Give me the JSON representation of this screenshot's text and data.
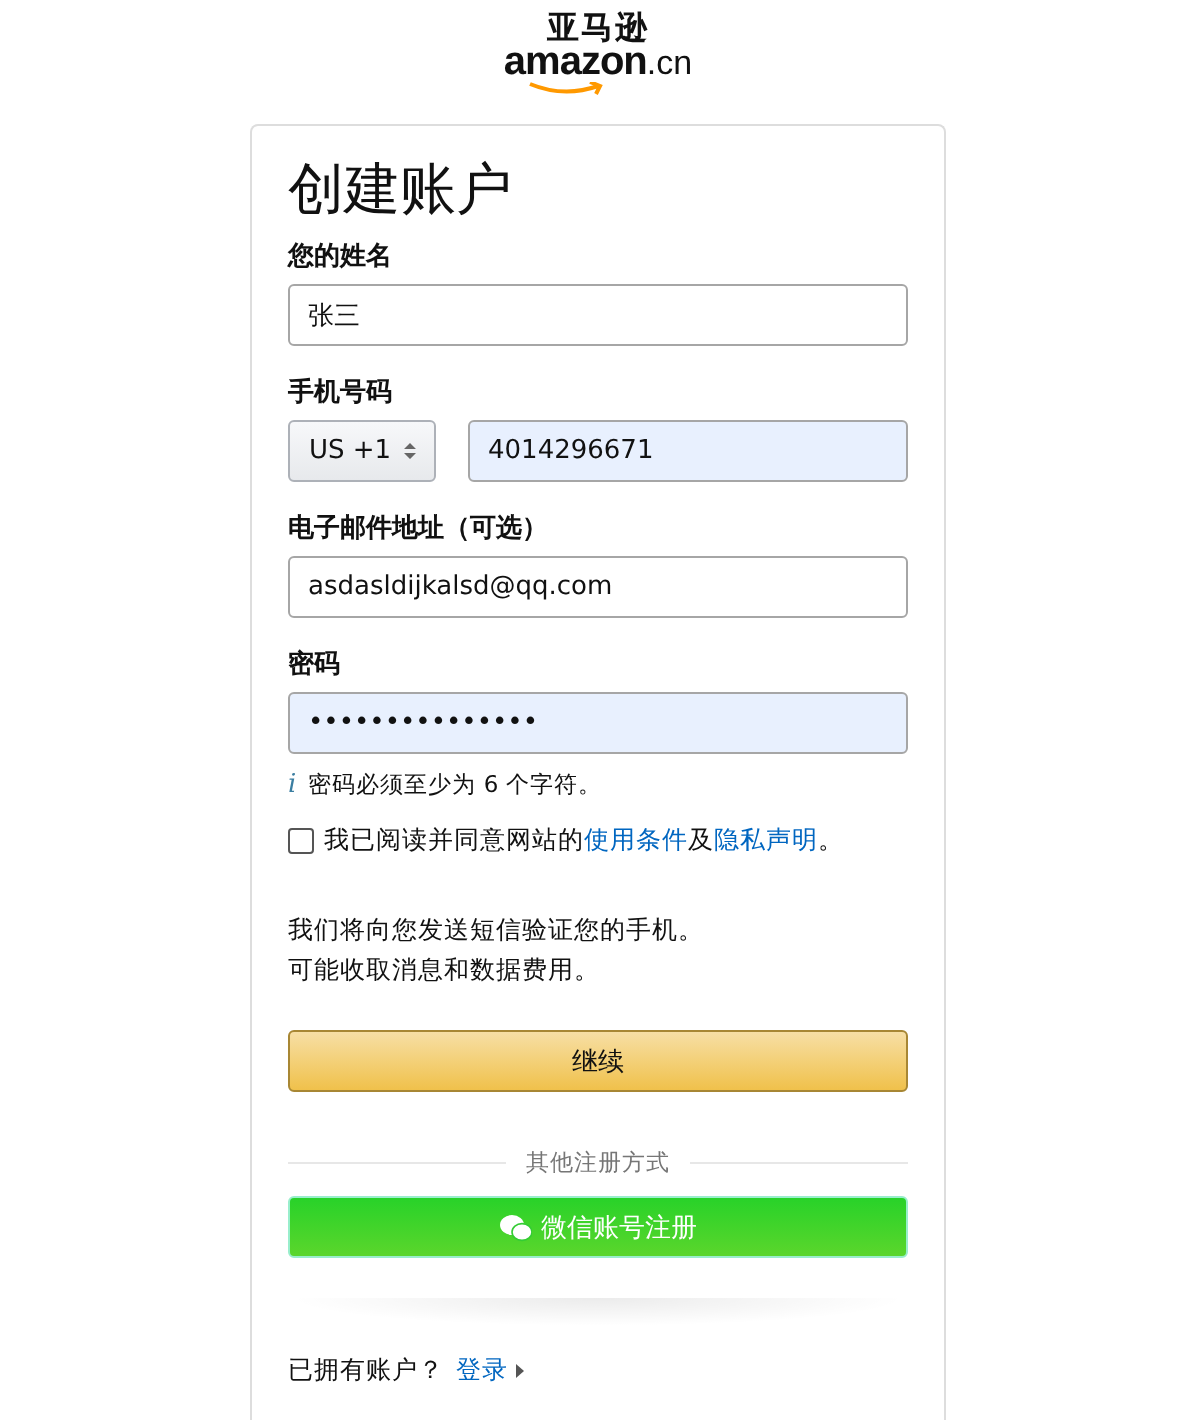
{
  "logo": {
    "chinese": "亚马逊",
    "latin": "amazon",
    "suffix": ".cn"
  },
  "title": "创建账户",
  "fields": [
    {
      "kind": "text",
      "label": "您的姓名",
      "value": "张三",
      "autofilled": false
    },
    {
      "kind": "phone",
      "label": "手机号码",
      "country": "US +1",
      "value": "4014296671",
      "autofilled": true
    },
    {
      "kind": "text",
      "label": "电子邮件地址（可选）",
      "value": "asdasldijkalsd@qq.com",
      "autofilled": false
    },
    {
      "kind": "text",
      "label": "密码",
      "value": "•••••••••••••••",
      "autofilled": true
    }
  ],
  "password_hint": {
    "icon": "i",
    "text": "密码必须至少为 6 个字符。"
  },
  "terms": {
    "checked": false,
    "prefix": "我已阅读并同意网站的",
    "link_1": "使用条件",
    "middle": "及",
    "link_2": "隐私声明",
    "suffix": "。"
  },
  "sms_notice": [
    "我们将向您发送短信验证您的手机。",
    "可能收取消息和数据费用。"
  ],
  "continue_button": "继续",
  "divider_label": "其他注册方式",
  "wechat_button": "微信账号注册",
  "signin": {
    "prompt": "已拥有账户？",
    "link": "登录"
  }
}
